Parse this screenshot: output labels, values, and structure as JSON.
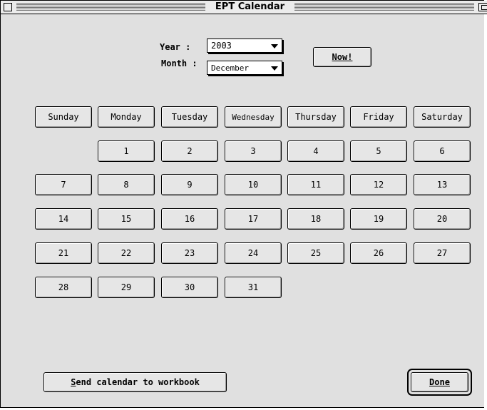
{
  "window": {
    "title": "EPT Calendar"
  },
  "controls": {
    "year_label": "Year :",
    "year_value": "2003",
    "month_label": "Month :",
    "month_value": "December",
    "now_button_label": "Now!"
  },
  "weekdays": [
    "Sunday",
    "Monday",
    "Tuesday",
    "Wednesday",
    "Thursday",
    "Friday",
    "Saturday"
  ],
  "days": [
    "1",
    "2",
    "3",
    "4",
    "5",
    "6",
    "7",
    "8",
    "9",
    "10",
    "11",
    "12",
    "13",
    "14",
    "15",
    "16",
    "17",
    "18",
    "19",
    "20",
    "21",
    "22",
    "23",
    "24",
    "25",
    "26",
    "27",
    "28",
    "29",
    "30",
    "31"
  ],
  "first_weekday_index": 1,
  "footer": {
    "send_button_label": "Send calendar to workbook",
    "done_button_label": "Done"
  }
}
